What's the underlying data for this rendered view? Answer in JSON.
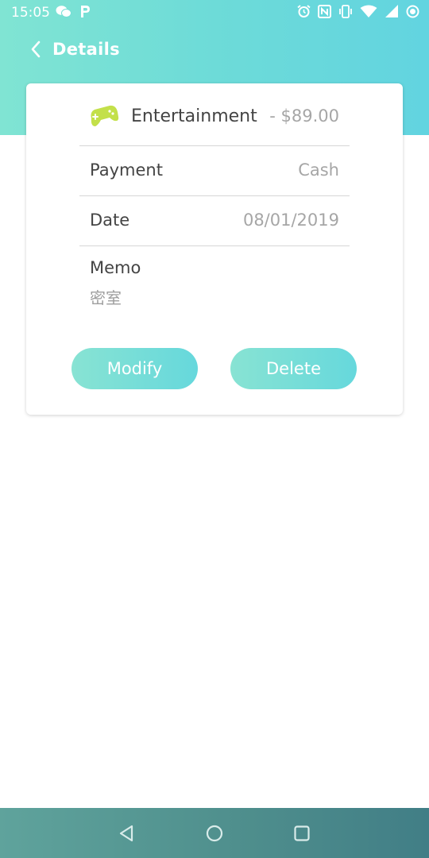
{
  "status_bar": {
    "time": "15:05",
    "left_icons": [
      "wechat-icon",
      "parking-p-icon"
    ],
    "right_icons": [
      "alarm-icon",
      "nfc-icon",
      "vibrate-icon",
      "wifi-icon",
      "signal-icon",
      "record-icon"
    ]
  },
  "header": {
    "title": "Details",
    "back_icon": "chevron-left-icon"
  },
  "record": {
    "category": "Entertainment",
    "category_icon": "gamepad-icon",
    "amount": "- $89.00",
    "payment_label": "Payment",
    "payment_value": "Cash",
    "date_label": "Date",
    "date_value": "08/01/2019",
    "memo_label": "Memo",
    "memo_value": "密室"
  },
  "actions": {
    "modify_label": "Modify",
    "delete_label": "Delete"
  },
  "nav": {
    "icons": [
      "back-triangle-icon",
      "home-circle-icon",
      "recents-square-icon"
    ]
  },
  "colors": {
    "header_gradient_start": "#80e4d3",
    "header_gradient_end": "#62d4e0",
    "icon_green": "#c3e04a",
    "button_gradient_start": "#88e3d3",
    "button_gradient_end": "#66d8dc",
    "navbar": "#4f8f8d"
  }
}
